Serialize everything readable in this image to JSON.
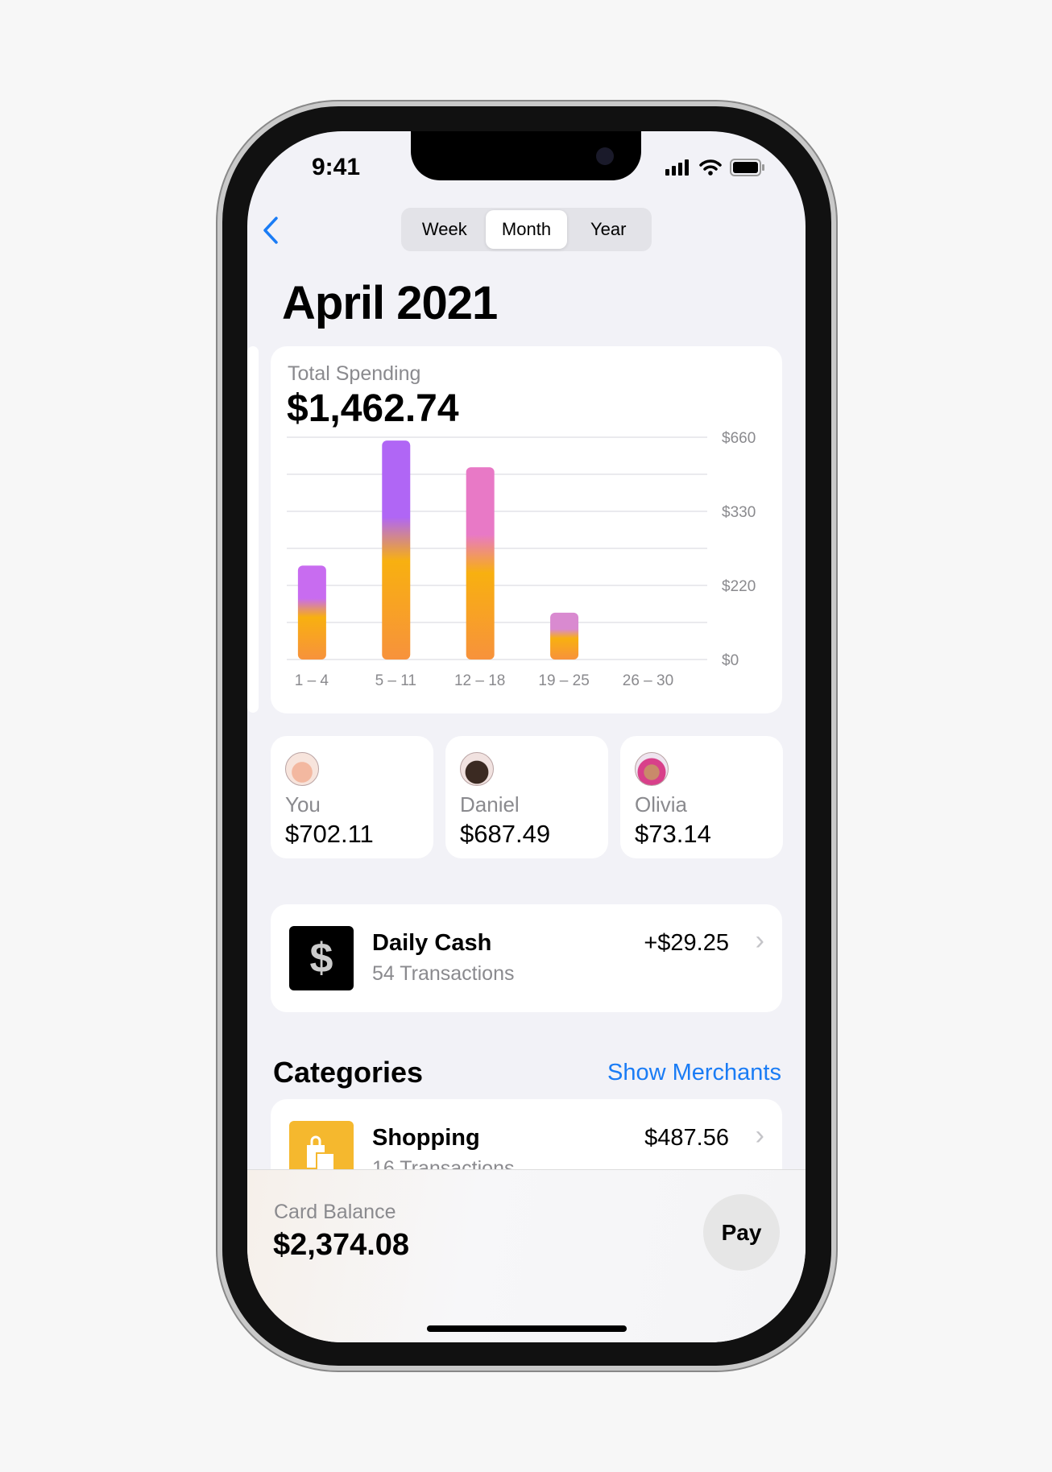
{
  "status_bar": {
    "time": "9:41"
  },
  "nav": {
    "back_icon": "chevron-left-icon",
    "segments": [
      "Week",
      "Month",
      "Year"
    ],
    "selected": "Month"
  },
  "page_title": "April 2021",
  "spending": {
    "label": "Total Spending",
    "total": "$1,462.74"
  },
  "chart_data": {
    "type": "bar",
    "categories": [
      "1 – 4",
      "5 – 11",
      "12 – 18",
      "19 – 25",
      "26 – 30"
    ],
    "values": [
      279,
      650,
      571,
      139,
      0
    ],
    "y_tick_labels": [
      "$660",
      "$330",
      "$220",
      "$0"
    ],
    "ylim": [
      0,
      660
    ],
    "grid": true,
    "colors": {
      "top": [
        "#c86cf0",
        "#b066f5",
        "#e879c6",
        "#d98ad0"
      ],
      "bottom": "#f7923c",
      "mid": "#f8b010"
    }
  },
  "people": [
    {
      "name": "You",
      "amount": "$702.11",
      "color": "#f7d9cf"
    },
    {
      "name": "Daniel",
      "amount": "$687.49",
      "color": "#3b2a22"
    },
    {
      "name": "Olivia",
      "amount": "$73.14",
      "color": "#d8408a"
    }
  ],
  "daily_cash": {
    "title": "Daily Cash",
    "subtitle": "54 Transactions",
    "amount": "+$29.25",
    "icon": "dollar-sign-icon"
  },
  "categories": {
    "heading": "Categories",
    "link": "Show Merchants",
    "accent": "#1a7cf5",
    "items": [
      {
        "title": "Shopping",
        "subtitle": "16 Transactions",
        "amount": "$487.56",
        "icon": "shopping-bag-icon",
        "color": "#f5b82e"
      }
    ]
  },
  "balance": {
    "label": "Card Balance",
    "amount": "$2,374.08",
    "pay_label": "Pay"
  }
}
